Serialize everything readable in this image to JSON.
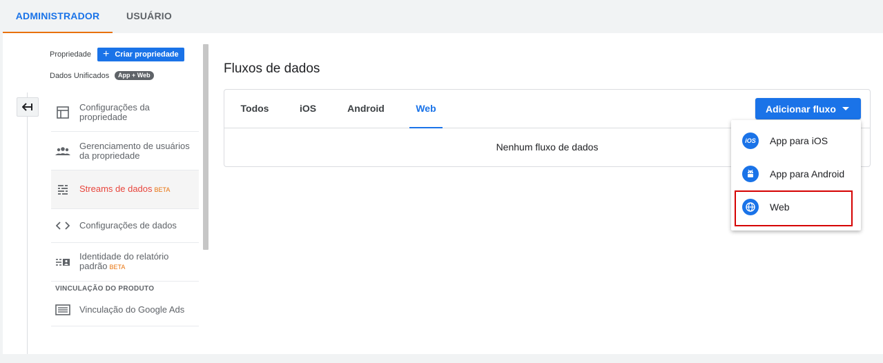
{
  "top_tabs": {
    "admin": "ADMINISTRADOR",
    "user": "USUÁRIO"
  },
  "sidebar": {
    "property_label": "Propriedade",
    "create_property": "Criar propriedade",
    "unified_label": "Dados Unificados",
    "unified_badge": "App + Web",
    "items": [
      {
        "label": "Configurações da propriedade"
      },
      {
        "label": "Gerenciamento de usuários da propriedade"
      },
      {
        "label": "Streams de dados",
        "badge": "BETA"
      },
      {
        "label": "Configurações de dados"
      },
      {
        "label": "Identidade do relatório padrão",
        "badge": "BETA"
      }
    ],
    "section_product_linking": "VINCULAÇÃO DO PRODUTO",
    "ads_item": "Vinculação do Google Ads"
  },
  "main": {
    "title": "Fluxos de dados",
    "tabs": [
      "Todos",
      "iOS",
      "Android",
      "Web"
    ],
    "active_tab": "Web",
    "empty_message": "Nenhum fluxo de dados",
    "add_button": "Adicionar fluxo",
    "dropdown": [
      {
        "label": "App para iOS",
        "icon": "ios-icon",
        "icon_text": "iOS"
      },
      {
        "label": "App para Android",
        "icon": "android-icon"
      },
      {
        "label": "Web",
        "icon": "globe-icon"
      }
    ]
  },
  "colors": {
    "primary": "#1a73e8",
    "accent": "#e8710a",
    "active_item": "#e8453c",
    "highlight": "#d50000"
  }
}
